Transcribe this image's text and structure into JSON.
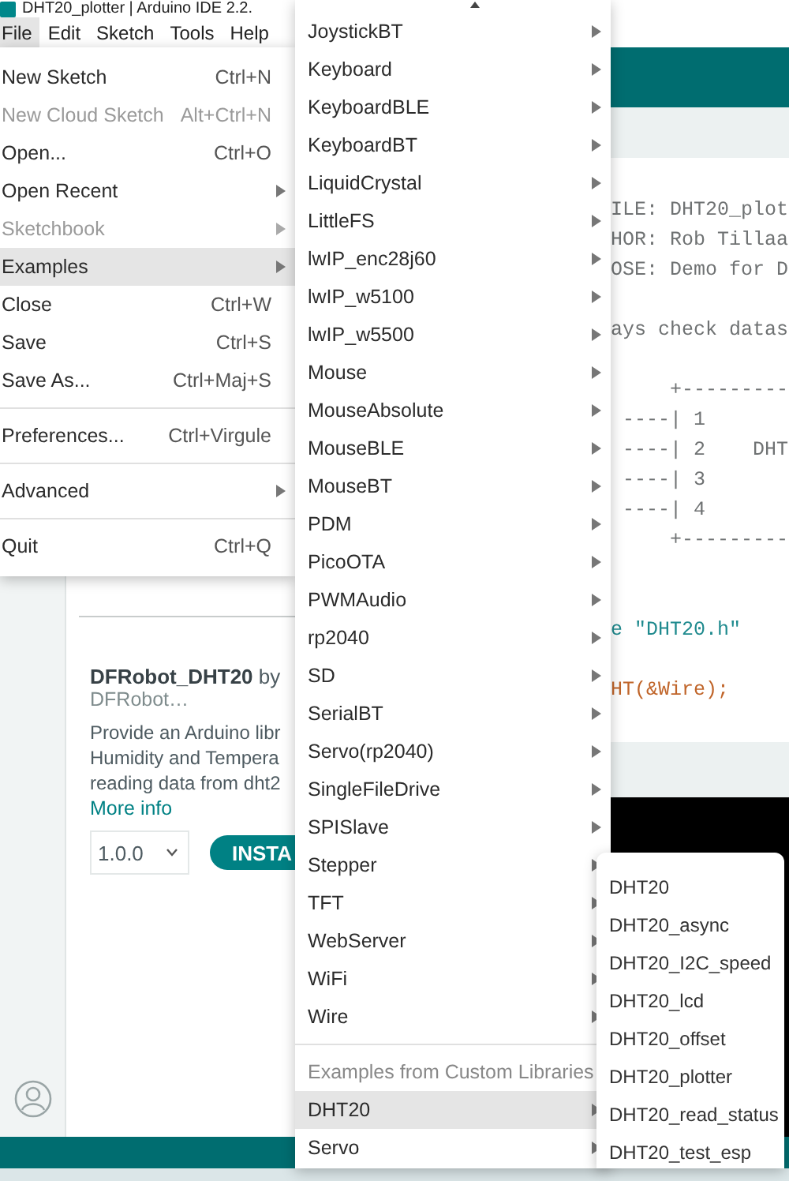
{
  "window": {
    "title": "DHT20_plotter | Arduino IDE 2.2."
  },
  "menu_bar": [
    {
      "label": "File",
      "selected": true
    },
    {
      "label": "Edit",
      "selected": false
    },
    {
      "label": "Sketch",
      "selected": false
    },
    {
      "label": "Tools",
      "selected": false
    },
    {
      "label": "Help",
      "selected": false
    }
  ],
  "file_menu": {
    "groups": [
      {
        "items": [
          {
            "label": "New Sketch",
            "shortcut": "Ctrl+N",
            "submenu": false,
            "disabled": false,
            "selected": false
          },
          {
            "label": "New Cloud Sketch",
            "shortcut": "Alt+Ctrl+N",
            "submenu": false,
            "disabled": true,
            "selected": false
          },
          {
            "label": "Open...",
            "shortcut": "Ctrl+O",
            "submenu": false,
            "disabled": false,
            "selected": false
          },
          {
            "label": "Open Recent",
            "submenu": true,
            "disabled": false,
            "selected": false
          },
          {
            "label": "Sketchbook",
            "submenu": true,
            "disabled": true,
            "selected": false
          },
          {
            "label": "Examples",
            "submenu": true,
            "disabled": false,
            "selected": true
          },
          {
            "label": "Close",
            "shortcut": "Ctrl+W",
            "submenu": false,
            "disabled": false,
            "selected": false
          },
          {
            "label": "Save",
            "shortcut": "Ctrl+S",
            "submenu": false,
            "disabled": false,
            "selected": false
          },
          {
            "label": "Save As...",
            "shortcut": "Ctrl+Maj+S",
            "submenu": false,
            "disabled": false,
            "selected": false
          }
        ]
      },
      {
        "items": [
          {
            "label": "Preferences...",
            "shortcut": "Ctrl+Virgule",
            "submenu": false,
            "disabled": false,
            "selected": false
          }
        ]
      },
      {
        "items": [
          {
            "label": "Advanced",
            "submenu": true,
            "disabled": false,
            "selected": false
          }
        ]
      },
      {
        "items": [
          {
            "label": "Quit",
            "shortcut": "Ctrl+Q",
            "submenu": false,
            "disabled": false,
            "selected": false
          }
        ]
      }
    ]
  },
  "examples_menu": {
    "groups": [
      {
        "items": [
          {
            "label": "JoystickBT",
            "selected": false
          },
          {
            "label": "Keyboard",
            "selected": false
          },
          {
            "label": "KeyboardBLE",
            "selected": false
          },
          {
            "label": "KeyboardBT",
            "selected": false
          },
          {
            "label": "LiquidCrystal",
            "selected": false
          },
          {
            "label": "LittleFS",
            "selected": false
          },
          {
            "label": "lwIP_enc28j60",
            "selected": false
          },
          {
            "label": "lwIP_w5100",
            "selected": false
          },
          {
            "label": "lwIP_w5500",
            "selected": false
          },
          {
            "label": "Mouse",
            "selected": false
          },
          {
            "label": "MouseAbsolute",
            "selected": false
          },
          {
            "label": "MouseBLE",
            "selected": false
          },
          {
            "label": "MouseBT",
            "selected": false
          },
          {
            "label": "PDM",
            "selected": false
          },
          {
            "label": "PicoOTA",
            "selected": false
          },
          {
            "label": "PWMAudio",
            "selected": false
          },
          {
            "label": "rp2040",
            "selected": false
          },
          {
            "label": "SD",
            "selected": false
          },
          {
            "label": "SerialBT",
            "selected": false
          },
          {
            "label": "Servo(rp2040)",
            "selected": false
          },
          {
            "label": "SingleFileDrive",
            "selected": false
          },
          {
            "label": "SPISlave",
            "selected": false
          },
          {
            "label": "Stepper",
            "selected": false
          },
          {
            "label": "TFT",
            "selected": false
          },
          {
            "label": "WebServer",
            "selected": false
          },
          {
            "label": "WiFi",
            "selected": false
          },
          {
            "label": "Wire",
            "selected": false
          }
        ]
      },
      {
        "header": "Examples from Custom Libraries",
        "items": [
          {
            "label": "DHT20",
            "selected": true
          },
          {
            "label": "Servo",
            "selected": false
          }
        ]
      }
    ]
  },
  "dht20_menu": [
    "DHT20",
    "DHT20_async",
    "DHT20_I2C_speed",
    "DHT20_lcd",
    "DHT20_offset",
    "DHT20_plotter",
    "DHT20_read_status",
    "DHT20_test_esp"
  ],
  "library": {
    "title": "**DFRobot_DHT20** by",
    "author": "DFRobot…",
    "description_lines": [
      "Provide an Arduino libr",
      "Humidity and Tempera",
      "reading data from dht2"
    ],
    "link": "More info",
    "version": "1.0.0",
    "install_button": "INSTA"
  },
  "editor": {
    "lines": [
      {
        "kind": "comment",
        "text": "ILE: DHT20_plot"
      },
      {
        "kind": "comment",
        "text": "HOR: Rob Tillaa"
      },
      {
        "kind": "comment",
        "text": "OSE: Demo for D"
      },
      {
        "kind": "blank"
      },
      {
        "kind": "comment",
        "text": "ays check datas"
      },
      {
        "kind": "blank"
      },
      {
        "kind": "comment",
        "text": "     +---------"
      },
      {
        "kind": "comment",
        "text": " ----| 1"
      },
      {
        "kind": "comment",
        "text": " ----| 2    DHT"
      },
      {
        "kind": "comment",
        "text": " ----| 3"
      },
      {
        "kind": "comment",
        "text": " ----| 4"
      },
      {
        "kind": "comment",
        "text": "     +---------"
      },
      {
        "kind": "blank"
      },
      {
        "kind": "blank"
      },
      {
        "kind": "include",
        "text": "e \"DHT20.h\""
      },
      {
        "kind": "blank"
      },
      {
        "kind": "code",
        "text": "HT(&Wire);"
      }
    ]
  }
}
